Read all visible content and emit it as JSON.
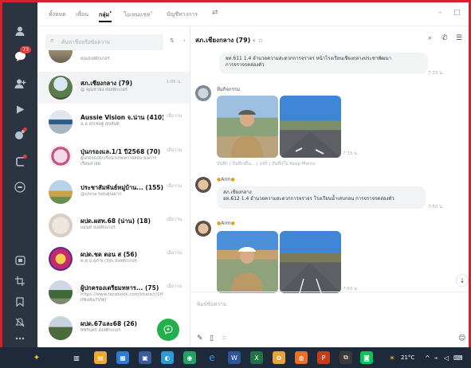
{
  "tabs": [
    {
      "label": "ทั้งหมด",
      "active": false
    },
    {
      "label": "เพื่อน",
      "active": false
    },
    {
      "label": "กลุ่ม",
      "active": true,
      "marker": "•"
    },
    {
      "label": "โอเพนแชท",
      "active": false,
      "marker": "•"
    },
    {
      "label": "บัญชีทางการ",
      "active": false
    }
  ],
  "window": {
    "minimize": "–",
    "maximize": "□"
  },
  "rail": {
    "chat_badge": "73"
  },
  "search": {
    "placeholder": "ค้นหาชื่อหรือข้อความ"
  },
  "chats": [
    {
      "name": "",
      "sub": "คุณส่งสติกเกอร์",
      "time": "",
      "avatar": "group-1"
    },
    {
      "name": "สภ.เชียงกลาง (79)",
      "sub": "@ คุณชวนั้ง ส่งสติกเกอร์",
      "time": "1:06 น.",
      "avatar": "group-2",
      "selected": true
    },
    {
      "name": "Aussie Vision จ.น่าน (410)",
      "sub": "น.อ.สุรเชษฐ์ สุขสันต์",
      "time": "เมื่อวาน",
      "avatar": "group-3"
    },
    {
      "name": "ปุ่นกรองแล.1/1 ปี2568 (70)",
      "sub": "ผู้ปกครองนักเรียนโปรดตรวจสอบ ผลการเรียนล่าสุด",
      "time": "เมื่อวาน",
      "avatar": "group-4"
    },
    {
      "name": "ประชาสัมพันธ์หมู่บ้าน... (155)",
      "sub": "@china ขอบคุณมาก",
      "time": "เมื่อวาน",
      "avatar": "group-5"
    },
    {
      "name": "ผปด.ผสท.68 (น่าน) (18)",
      "sub": "แอนท์ ส่งสติกเกอร์",
      "time": "เมื่อวาน",
      "avatar": "group-6"
    },
    {
      "name": "ผปด.ชด ตอน ส (56)",
      "sub": "พ.ต.อ.สุภ์ ช.(39) ส่งสติกเกอร์",
      "time": "เมื่อวาน",
      "avatar": "group-7"
    },
    {
      "name": "ผู้ปกครองเตรียมทหาร... (75)",
      "sub": "https://www.facebook.com/share/r/1HifNd8a7VW/",
      "time": "เมื่อวาน",
      "avatar": "group-8"
    },
    {
      "name": "ผปด.67และ68 (26)",
      "sub": "พัชรินทร์ ส่งสติกเกอร์",
      "time": "เมื่อวาน",
      "avatar": "group-9"
    }
  ],
  "chat": {
    "title": "สภ.เชียงกลาง (79)",
    "messages": [
      {
        "text_line1": "ยท.611 1.4 อำนวยความสะดวกการจราจร หน้าโรงเรียนเชียงกลางประชาพัฒนา",
        "text_line2": "การจราจรคล่องตัว",
        "time": "7:33 น."
      },
      {
        "sender": "ทีมกิจกรรม",
        "time": "7:33 น.",
        "keep": "บันทึก | บันทึกเป็น... | แชร์ | บันทึกใน Keep Memo"
      },
      {
        "sender": "Arm",
        "text_line1": "สภ.เชียงกลาง",
        "text_line2": "ยท.612 1.4 อำนวยความสะดวกการจราจร โรงเรียนน้ำเสบกอน การจราจรคล่องตัว",
        "time": "7:50 น."
      },
      {
        "sender": "Arm",
        "time": "7:50 น."
      }
    ],
    "composer_placeholder": "พิมพ์ข้อความ"
  },
  "taskbar": {
    "temperature": "21°C"
  },
  "colors": {
    "rail": "#2b3440",
    "accent": "#21b04b",
    "taskbar": "#1e2a3a",
    "border": "#d6202a"
  }
}
